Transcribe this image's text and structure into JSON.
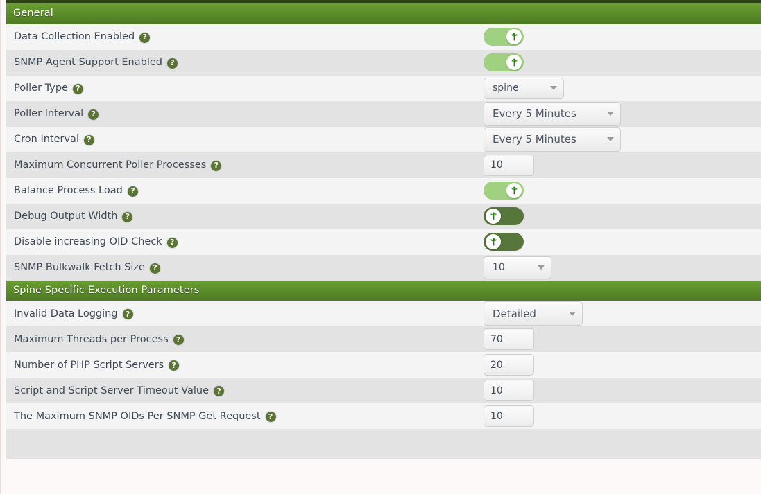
{
  "page": {
    "background_color": "#fdf9f8",
    "row_light_color": "#f4f4f4",
    "row_dark_color": "#e3e3e3",
    "header_green": "#5b8c2a",
    "toggle_on_color": "#9fd180",
    "toggle_off_color": "#57763c",
    "help_icon_color": "#5c7431",
    "label_text_color": "#3f4a56"
  },
  "sections": [
    {
      "title": "General",
      "rows": [
        {
          "label": "Data Collection Enabled",
          "help": "?",
          "control": "toggle",
          "state": "on"
        },
        {
          "label": "SNMP Agent Support Enabled",
          "help": "?",
          "control": "toggle",
          "state": "on"
        },
        {
          "label": "Poller Type",
          "help": "?",
          "control": "select",
          "value": "spine",
          "size": "spine"
        },
        {
          "label": "Poller Interval",
          "help": "?",
          "control": "select",
          "value": "Every 5 Minutes",
          "size": "interval"
        },
        {
          "label": "Cron Interval",
          "help": "?",
          "control": "select",
          "value": "Every 5 Minutes",
          "size": "interval"
        },
        {
          "label": "Maximum Concurrent Poller Processes",
          "help": "?",
          "control": "input",
          "value": "10"
        },
        {
          "label": "Balance Process Load",
          "help": "?",
          "control": "toggle",
          "state": "on"
        },
        {
          "label": "Debug Output Width",
          "help": "?",
          "control": "toggle",
          "state": "off"
        },
        {
          "label": "Disable increasing OID Check",
          "help": "?",
          "control": "toggle",
          "state": "off"
        },
        {
          "label": "SNMP Bulkwalk Fetch Size",
          "help": "?",
          "control": "select",
          "value": "10",
          "size": "bulk"
        }
      ]
    },
    {
      "title": "Spine Specific Execution Parameters",
      "rows": [
        {
          "label": "Invalid Data Logging",
          "help": "?",
          "control": "select",
          "value": "Detailed",
          "size": "detail"
        },
        {
          "label": "Maximum Threads per Process",
          "help": "?",
          "control": "input",
          "value": "70"
        },
        {
          "label": "Number of PHP Script Servers",
          "help": "?",
          "control": "input",
          "value": "20"
        },
        {
          "label": "Script and Script Server Timeout Value",
          "help": "?",
          "control": "input",
          "value": "10"
        },
        {
          "label": "The Maximum SNMP OIDs Per SNMP Get Request",
          "help": "?",
          "control": "input",
          "value": "10"
        }
      ]
    }
  ],
  "icons": {
    "help": "help-circle-icon",
    "toggle_knob": "sprout-icon",
    "caret": "chevron-down-icon"
  }
}
